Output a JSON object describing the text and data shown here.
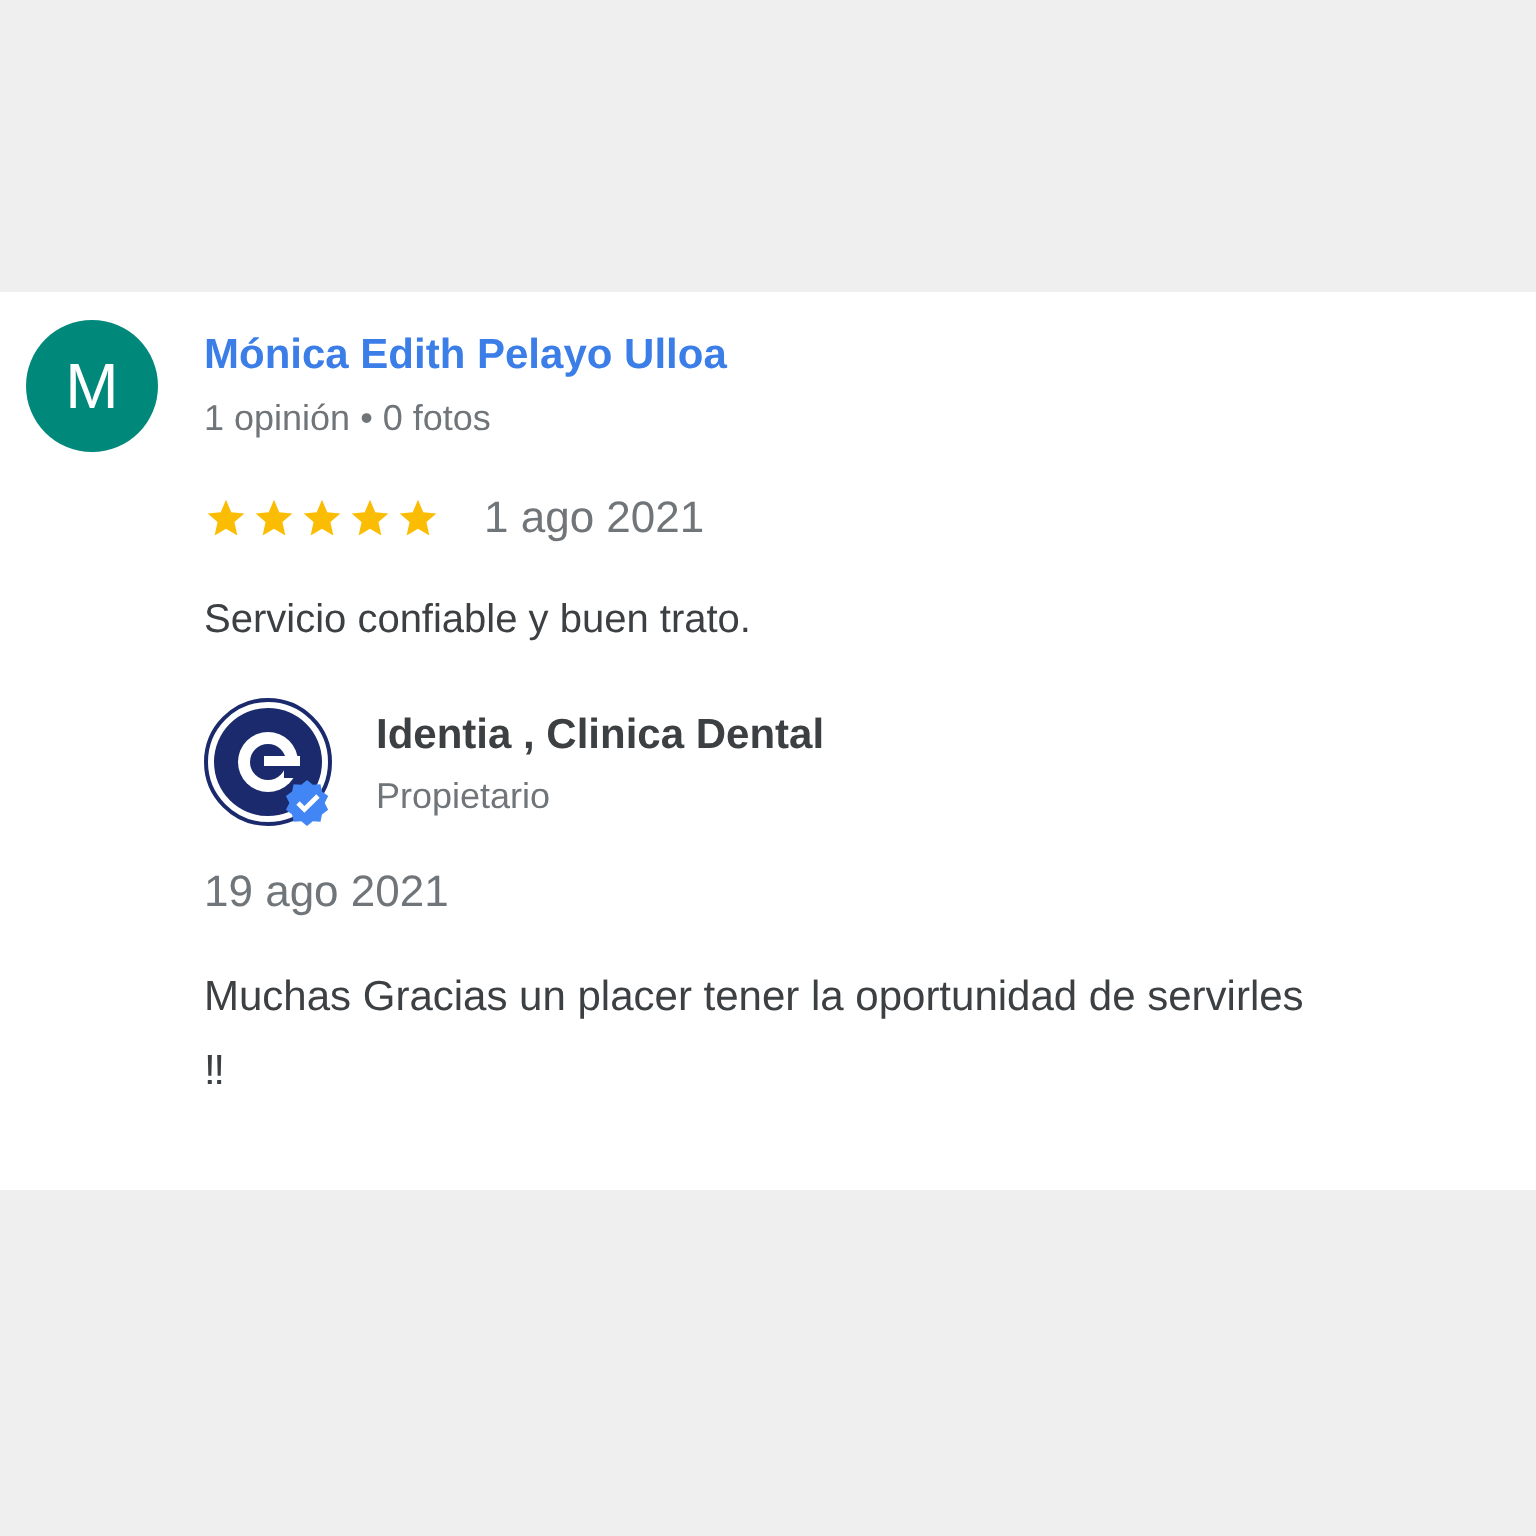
{
  "review": {
    "avatar_letter": "M",
    "author": "Mónica Edith Pelayo Ulloa",
    "author_meta": "1 opinión • 0 fotos",
    "stars": 5,
    "date": "1 ago 2021",
    "text": "Servicio confiable y buen trato."
  },
  "owner_reply": {
    "name": "Identia , Clinica Dental",
    "role": "Propietario",
    "verified": true,
    "date": "19 ago 2021",
    "text": "Muchas Gracias un placer tener la oportunidad de servirles ‼"
  }
}
